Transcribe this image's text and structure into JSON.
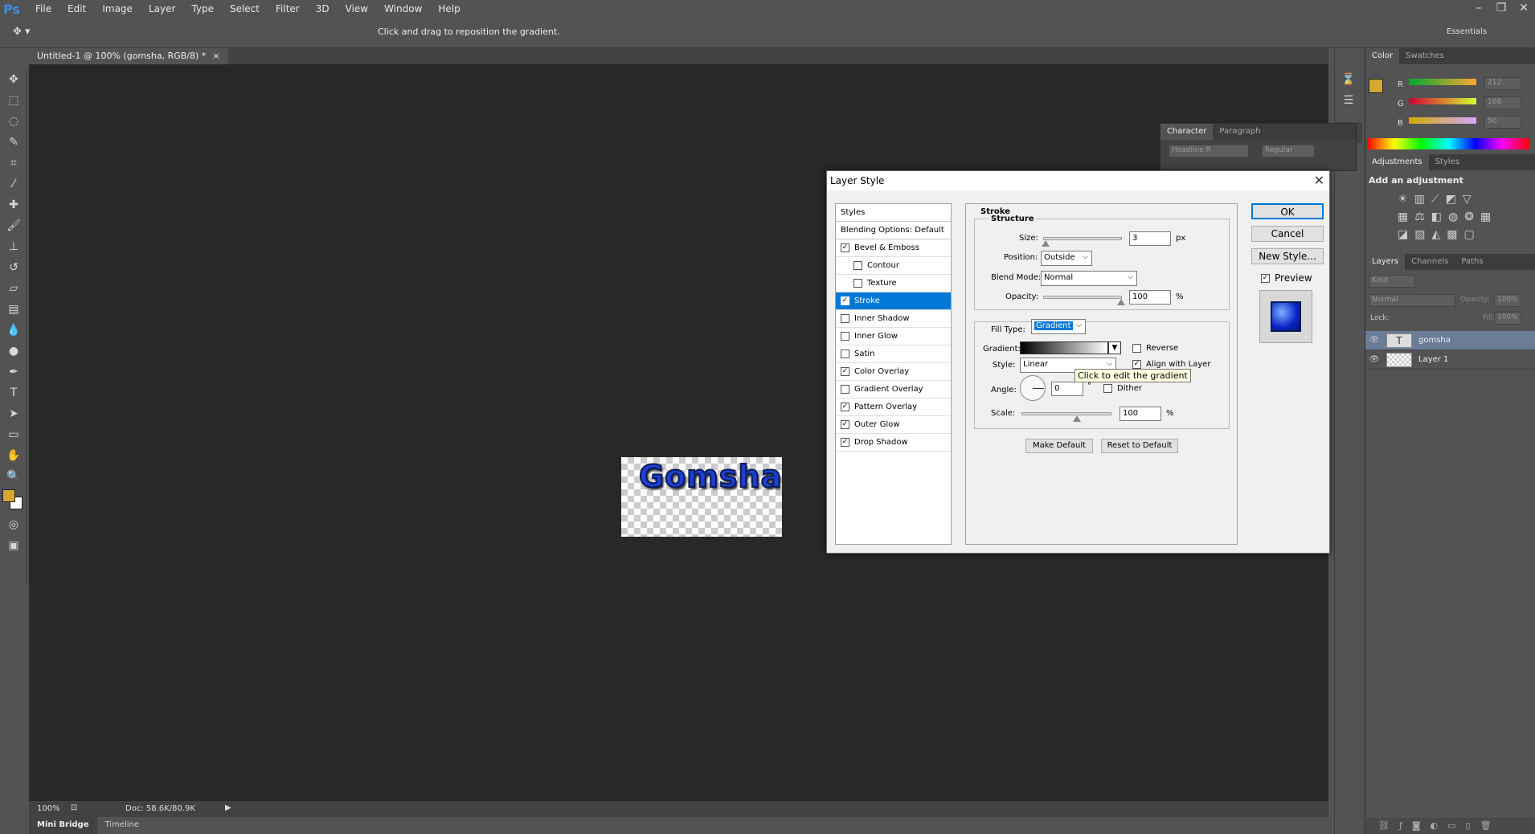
{
  "app": {
    "logo": "Ps",
    "menu": [
      "File",
      "Edit",
      "Image",
      "Layer",
      "Type",
      "Select",
      "Filter",
      "3D",
      "View",
      "Window",
      "Help"
    ],
    "options_hint": "Click and drag to reposition the gradient.",
    "workspace_label": "Essentials"
  },
  "document": {
    "tab_title": "Untitled-1 @ 100% (gomsha, RGB/8) *",
    "close_glyph": "×",
    "canvas_text": "Gomsha",
    "zoom": "100%",
    "doc_size": "Doc: 58.6K/80.9K"
  },
  "bottom_tabs": [
    "Mini Bridge",
    "Timeline"
  ],
  "character_panel": {
    "tabs": [
      "Character",
      "Paragraph"
    ],
    "font": "Headline R",
    "style": "Regular"
  },
  "color_panel": {
    "tabs": [
      "Color",
      "Swatches"
    ],
    "swatch_color": "#d4a832",
    "r_label": "R",
    "r_value": "212",
    "g_label": "G",
    "g_value": "168",
    "b_label": "B",
    "b_value": "50"
  },
  "adjustments_panel": {
    "tabs": [
      "Adjustments",
      "Styles"
    ],
    "title": "Add an adjustment"
  },
  "layers_panel": {
    "tabs": [
      "Layers",
      "Channels",
      "Paths"
    ],
    "filter": "Kind",
    "blend": "Normal",
    "opacity_label": "Opacity:",
    "opacity_value": "100%",
    "lock_label": "Lock:",
    "fill_label": "Fill:",
    "fill_value": "100%",
    "layers": [
      {
        "name": "gomsha",
        "type": "text",
        "selected": true
      },
      {
        "name": "Layer 1",
        "type": "pixel",
        "selected": false
      }
    ]
  },
  "dialog": {
    "title": "Layer Style",
    "styles_header": "Styles",
    "blending": "Blending Options: Default",
    "items": [
      {
        "label": "Bevel & Emboss",
        "checked": true,
        "sub": false,
        "selected": false
      },
      {
        "label": "Contour",
        "checked": false,
        "sub": true,
        "selected": false
      },
      {
        "label": "Texture",
        "checked": false,
        "sub": true,
        "selected": false
      },
      {
        "label": "Stroke",
        "checked": true,
        "sub": false,
        "selected": true
      },
      {
        "label": "Inner Shadow",
        "checked": false,
        "sub": false,
        "selected": false
      },
      {
        "label": "Inner Glow",
        "checked": false,
        "sub": false,
        "selected": false
      },
      {
        "label": "Satin",
        "checked": false,
        "sub": false,
        "selected": false
      },
      {
        "label": "Color Overlay",
        "checked": true,
        "sub": false,
        "selected": false
      },
      {
        "label": "Gradient Overlay",
        "checked": false,
        "sub": false,
        "selected": false
      },
      {
        "label": "Pattern Overlay",
        "checked": true,
        "sub": false,
        "selected": false
      },
      {
        "label": "Outer Glow",
        "checked": true,
        "sub": false,
        "selected": false
      },
      {
        "label": "Drop Shadow",
        "checked": true,
        "sub": false,
        "selected": false
      }
    ],
    "section_title": "Stroke",
    "structure_title": "Structure",
    "size_label": "Size:",
    "size_value": "3",
    "size_unit": "px",
    "position_label": "Position:",
    "position_value": "Outside",
    "blend_label": "Blend Mode:",
    "blend_value": "Normal",
    "opacity_label": "Opacity:",
    "opacity_value": "100",
    "opacity_unit": "%",
    "fill_type_label": "Fill Type:",
    "fill_type_value": "Gradient",
    "gradient_label": "Gradient:",
    "reverse_label": "Reverse",
    "style_label": "Style:",
    "style_value": "Linear",
    "align_label": "Align with Layer",
    "tooltip": "Click to edit the gradient",
    "angle_label": "Angle:",
    "angle_value": "0",
    "angle_unit": "°",
    "dither_label": "Dither",
    "scale_label": "Scale:",
    "scale_value": "100",
    "scale_unit": "%",
    "make_default": "Make Default",
    "reset_default": "Reset to Default",
    "ok": "OK",
    "cancel": "Cancel",
    "new_style": "New Style...",
    "preview": "Preview"
  }
}
